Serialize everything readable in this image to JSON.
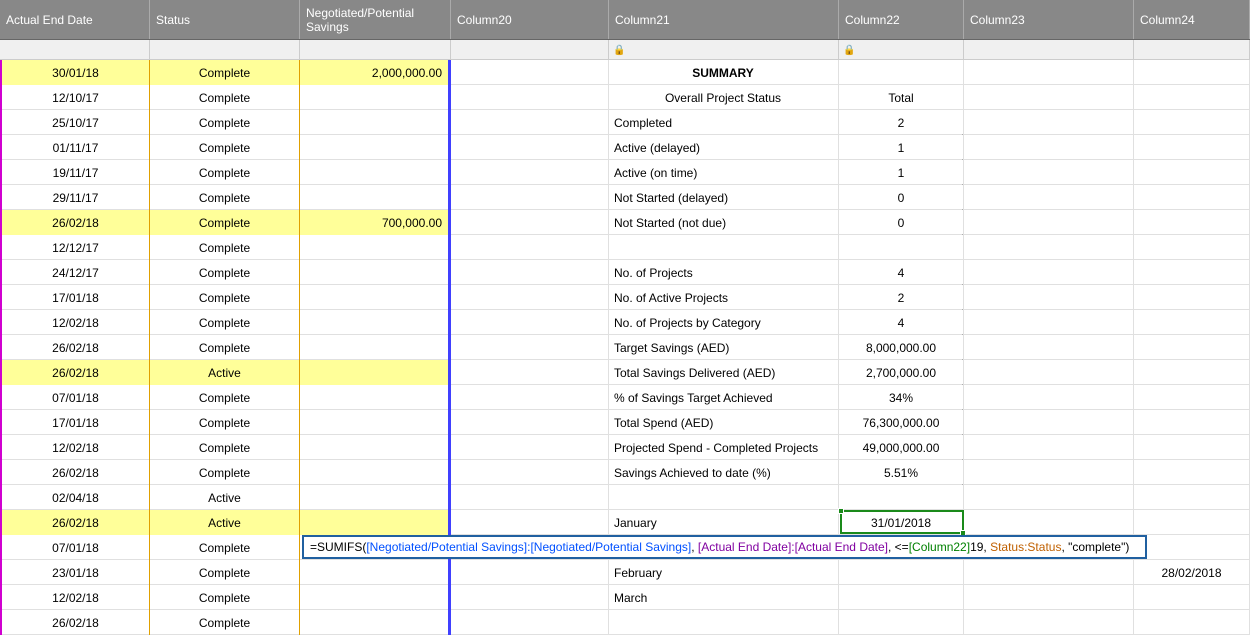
{
  "headers": {
    "c1": "Actual End Date",
    "c2": "Status",
    "c3": "Negotiated/Potential Savings",
    "c4": "Column20",
    "c5": "Column21",
    "c6": "Column22",
    "c7": "Column23",
    "c8": "Column24"
  },
  "lock": "🔒",
  "rows": [
    {
      "d": "30/01/18",
      "s": "Complete",
      "v": "2,000,000.00",
      "hl": true
    },
    {
      "d": "12/10/17",
      "s": "Complete",
      "v": ""
    },
    {
      "d": "25/10/17",
      "s": "Complete",
      "v": ""
    },
    {
      "d": "01/11/17",
      "s": "Complete",
      "v": ""
    },
    {
      "d": "19/11/17",
      "s": "Complete",
      "v": ""
    },
    {
      "d": "29/11/17",
      "s": "Complete",
      "v": ""
    },
    {
      "d": "26/02/18",
      "s": "Complete",
      "v": "700,000.00",
      "hl": true
    },
    {
      "d": "12/12/17",
      "s": "Complete",
      "v": ""
    },
    {
      "d": "24/12/17",
      "s": "Complete",
      "v": ""
    },
    {
      "d": "17/01/18",
      "s": "Complete",
      "v": ""
    },
    {
      "d": "12/02/18",
      "s": "Complete",
      "v": ""
    },
    {
      "d": "26/02/18",
      "s": "Complete",
      "v": ""
    },
    {
      "d": "26/02/18",
      "s": "Active",
      "v": "",
      "hl": true
    },
    {
      "d": "07/01/18",
      "s": "Complete",
      "v": ""
    },
    {
      "d": "17/01/18",
      "s": "Complete",
      "v": ""
    },
    {
      "d": "12/02/18",
      "s": "Complete",
      "v": ""
    },
    {
      "d": "26/02/18",
      "s": "Complete",
      "v": ""
    },
    {
      "d": "02/04/18",
      "s": "Active",
      "v": ""
    },
    {
      "d": "26/02/18",
      "s": "Active",
      "v": "",
      "hl": true
    },
    {
      "d": "07/01/18",
      "s": "Complete",
      "v": ""
    },
    {
      "d": "23/01/18",
      "s": "Complete",
      "v": ""
    },
    {
      "d": "12/02/18",
      "s": "Complete",
      "v": ""
    },
    {
      "d": "26/02/18",
      "s": "Complete",
      "v": ""
    }
  ],
  "summary": {
    "title": "SUMMARY",
    "sub": "Overall Project Status",
    "subTotal": "Total",
    "items": [
      {
        "l": "Completed",
        "v": "2"
      },
      {
        "l": "Active (delayed)",
        "v": "1"
      },
      {
        "l": "Active (on time)",
        "v": "1"
      },
      {
        "l": "Not Started (delayed)",
        "v": "0"
      },
      {
        "l": "Not Started (not due)",
        "v": "0"
      },
      {
        "l": "",
        "v": ""
      },
      {
        "l": "No. of Projects",
        "v": "4"
      },
      {
        "l": "No. of Active Projects",
        "v": "2"
      },
      {
        "l": "No. of Projects by Category",
        "v": "4"
      },
      {
        "l": "Target Savings (AED)",
        "v": "8,000,000.00"
      },
      {
        "l": "Total Savings Delivered (AED)",
        "v": "2,700,000.00"
      },
      {
        "l": "% of Savings Target Achieved",
        "v": "34%"
      },
      {
        "l": "Total Spend (AED)",
        "v": "76,300,000.00"
      },
      {
        "l": "Projected Spend - Completed Projects",
        "v": "49,000,000.00"
      },
      {
        "l": "Savings Achieved to date (%)",
        "v": "5.51%"
      },
      {
        "l": "",
        "v": ""
      },
      {
        "l": "January",
        "v": "31/01/2018"
      }
    ],
    "feb": "February",
    "febv": "28/02/2018",
    "mar": "March"
  },
  "formula": {
    "eq": "=SUMIFS(",
    "p1": "[Negotiated/Potential Savings]:[Negotiated/Potential Savings]",
    "c1": ", ",
    "p2": "[Actual End Date]:[Actual End Date]",
    "c2": ", <=",
    "p3": "[Column22]",
    "p3s": "19, ",
    "p4": "Status:Status",
    "c3": ", \"complete\")"
  }
}
